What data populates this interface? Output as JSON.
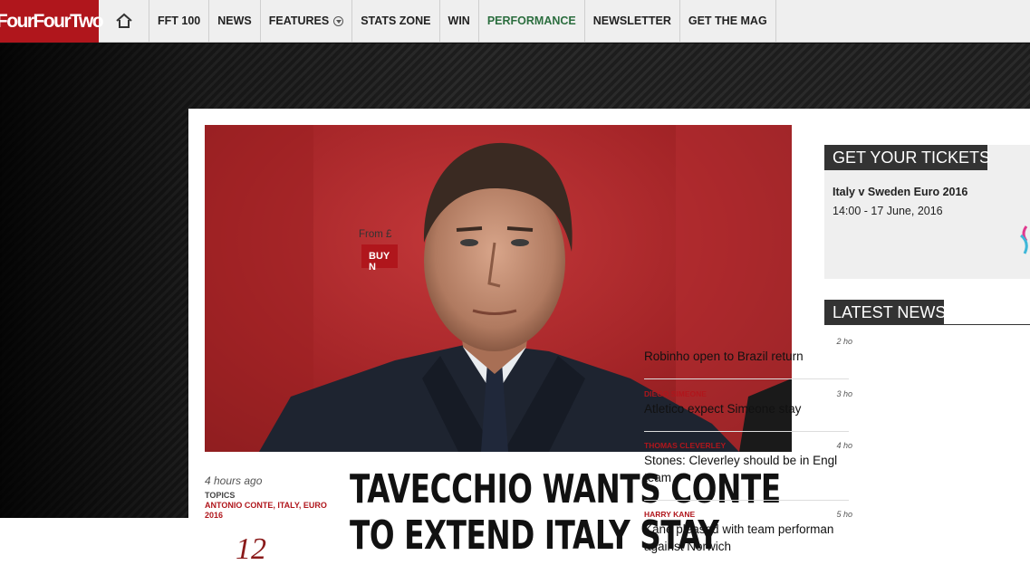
{
  "nav": {
    "logo": "FourFourTwo",
    "home_icon": "home-icon",
    "items": [
      {
        "label": "FFT 100"
      },
      {
        "label": "NEWS"
      },
      {
        "label": "FEATURES"
      },
      {
        "label": "STATS ZONE"
      },
      {
        "label": "WIN"
      },
      {
        "label": "PERFORMANCE"
      },
      {
        "label": "NEWSLETTER"
      },
      {
        "label": "GET THE MAG"
      }
    ],
    "accent_color": "#2c6e3f",
    "brand_color": "#b0161c"
  },
  "article": {
    "time": "4 hours ago",
    "topics_label": "TOPICS",
    "topics": "ANTONIO CONTE, ITALY, EURO 2016",
    "share_count": "12",
    "headline": "TAVECCHIO WANTS CONTE TO EXTEND ITALY STAY"
  },
  "tickets": {
    "title": "GET YOUR TICKETS",
    "match": "Italy v Sweden Euro 2016",
    "date": "14:00 - 17 June, 2016",
    "from": "From £",
    "buy": "BUY N"
  },
  "latest_news": {
    "title": "LATEST NEWS",
    "items": [
      {
        "tag": "",
        "time": "2 ho",
        "title": "Robinho open to Brazil return"
      },
      {
        "tag": "DIEGO SIMEONE",
        "time": "3 ho",
        "title": "Atletico expect Simeone stay"
      },
      {
        "tag": "THOMAS CLEVERLEY",
        "time": "4 ho",
        "title": "Stones: Cleverley should be in Engl team"
      },
      {
        "tag": "HARRY KANE",
        "time": "5 ho",
        "title": "Kane pleased with team performan against Norwich"
      }
    ]
  }
}
